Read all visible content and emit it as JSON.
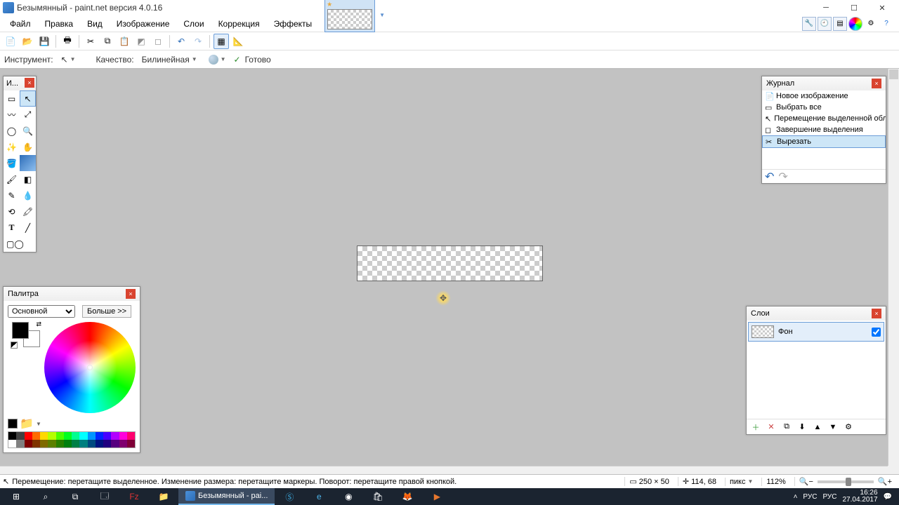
{
  "titlebar": {
    "title": "Безымянный - paint.net версия 4.0.16"
  },
  "menu": [
    "Файл",
    "Правка",
    "Вид",
    "Изображение",
    "Слои",
    "Коррекция",
    "Эффекты"
  ],
  "tooloptions": {
    "tool_label": "Инструмент:",
    "quality_label": "Качество:",
    "quality_value": "Билинейная",
    "status": "Готово"
  },
  "panels": {
    "tools_title": "И...",
    "history_title": "Журнал",
    "layers_title": "Слои",
    "colors_title": "Палитра",
    "color_mode": "Основной",
    "more": "Больше >>"
  },
  "history": [
    "Новое изображение",
    "Выбрать все",
    "Перемещение выделенной области",
    "Завершение выделения",
    "Вырезать"
  ],
  "layer": {
    "name": "Фон"
  },
  "statusbar": {
    "hint": "Перемещение: перетащите выделенное. Изменение размера: перетащите маркеры. Поворот: перетащите правой кнопкой.",
    "size": "250 × 50",
    "pos": "114, 68",
    "unit": "пикс",
    "zoom": "112%"
  },
  "taskbar": {
    "app": "Безымянный - pai...",
    "lang1": "РУС",
    "lang2": "РУС",
    "time": "16:26",
    "date": "27.04.2017"
  },
  "palette_colors": [
    "#000",
    "#404040",
    "#ff0000",
    "#ff6a00",
    "#ffd800",
    "#b6ff00",
    "#4cff00",
    "#00ff21",
    "#00ff90",
    "#00ffff",
    "#0094ff",
    "#0026ff",
    "#4800ff",
    "#b200ff",
    "#ff00dc",
    "#ff006e",
    "#fff",
    "#808080",
    "#7f0000",
    "#7f3300",
    "#7f6a00",
    "#5b7f00",
    "#267f00",
    "#007f0e",
    "#007f46",
    "#007f7f",
    "#004a7f",
    "#00137f",
    "#21007f",
    "#57007f",
    "#7f006e",
    "#7f0037"
  ]
}
